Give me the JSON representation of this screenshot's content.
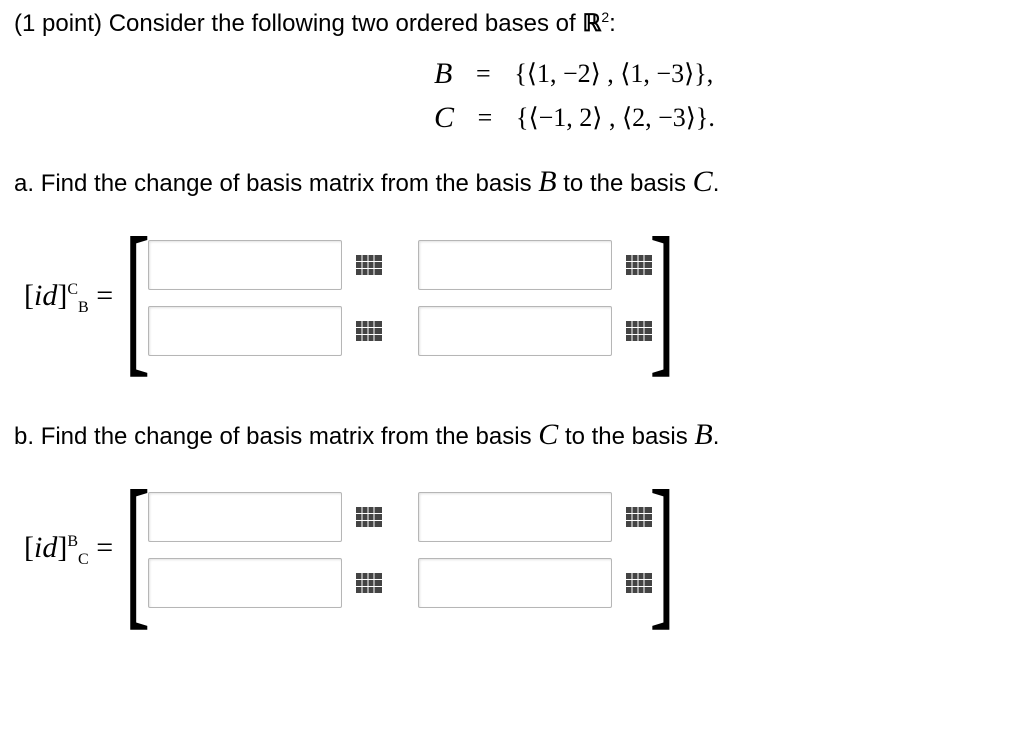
{
  "intro": "(1 point) Consider the following two ordered bases of ",
  "rlabel": "ℝ",
  "rexp": "2",
  "intro_tail": ":",
  "equations": {
    "B_name": "B",
    "B_rhs": "{⟨1, −2⟩ , ⟨1, −3⟩},",
    "C_name": "C",
    "C_rhs": "{⟨−1, 2⟩ , ⟨2, −3⟩}.",
    "eq": "="
  },
  "part_a": {
    "prefix": "a.",
    "text": "Find the change of basis matrix from the basis ",
    "from": "B",
    "mid": " to the basis ",
    "to": "C",
    "tail": "."
  },
  "part_b": {
    "prefix": "b.",
    "text": "Find the change of basis matrix from the basis ",
    "from": "C",
    "mid": " to the basis ",
    "to": "B",
    "tail": "."
  },
  "matrix_a": {
    "lhs_open": "[",
    "lhs_id": "id",
    "lhs_close": "]",
    "sup": "C",
    "sub": "B",
    "eq": " ="
  },
  "matrix_b": {
    "lhs_open": "[",
    "lhs_id": "id",
    "lhs_close": "]",
    "sup": "B",
    "sub": "C",
    "eq": " ="
  },
  "inputs": {
    "a11": "",
    "a12": "",
    "a21": "",
    "a22": "",
    "b11": "",
    "b12": "",
    "b21": "",
    "b22": ""
  }
}
